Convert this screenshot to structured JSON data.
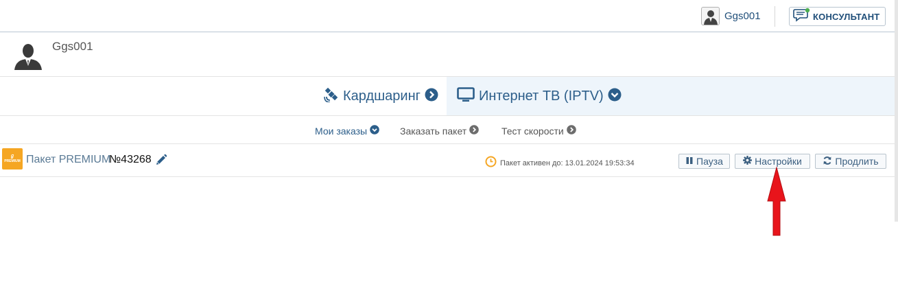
{
  "topbar": {
    "user_name": "Ggs001",
    "consultant_label": "КОНСУЛЬТАНТ"
  },
  "profile": {
    "name": "Ggs001"
  },
  "main_nav": {
    "cardsharing_label": "Кардшаринг",
    "iptv_label": "Интернет ТВ (IPTV)"
  },
  "sub_nav": {
    "items": [
      {
        "label": "Мои заказы",
        "active": true
      },
      {
        "label": "Заказать пакет",
        "active": false
      },
      {
        "label": "Тест скорости",
        "active": false
      }
    ]
  },
  "package": {
    "logo_text": "PREMIUM",
    "title": "Пакет PREMIUM",
    "number": "№43268",
    "status_text": "Пакет активен до: 13.01.2024 19:53:34",
    "buttons": {
      "pause": "Пауза",
      "settings": "Настройки",
      "extend": "Продлить"
    }
  },
  "colors": {
    "accent": "#2c5e8a",
    "link": "#1f4e79",
    "iptv_bg": "#eef5fb",
    "logo": "#f5a623",
    "annotation_arrow": "#e8141b"
  }
}
